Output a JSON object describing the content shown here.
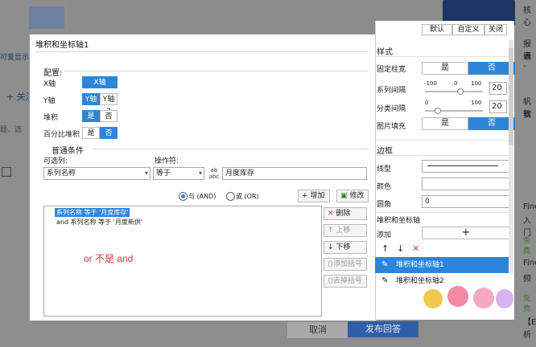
{
  "background": {
    "left_link": "可爱显示",
    "left_follow": "+ 关注",
    "left_misc": "题、选",
    "right_texts": [
      "核心",
      "报表",
      "通 -",
      "帆软",
      "赛",
      "Fine",
      "入门",
      "免费",
      "Fine",
      "频",
      "免费",
      "【E",
      "析"
    ],
    "cancel_label": "取消",
    "submit_label": "发布回答",
    "colors": {
      "submit": "#2f5fa8"
    }
  },
  "dialog": {
    "title": "堆积和坐标轴1",
    "config_label": "配置:",
    "x_axis_label": "X轴",
    "x_axis_value": "X轴",
    "y_axis_label": "Y轴",
    "y_axis_options": [
      "Y轴",
      "Y轴2"
    ],
    "stack_label": "堆积",
    "stack_options": [
      "是",
      "否"
    ],
    "percent_label": "百分比堆积",
    "percent_options": [
      "是",
      "否"
    ],
    "conditions_label": "普通条件",
    "selectable_label": "可选列:",
    "operator_label": "操作符:",
    "selected_column": "系列名称",
    "operator_value": "等于",
    "condition_value": "月度库存",
    "value_icon": "formula-icon",
    "and_label": "与 (AND)",
    "or_label": "或 (OR)",
    "add_label": "增加",
    "edit_label": "修改",
    "conditions": [
      "系列名称 等于 '月度库存'",
      "and 系列名称 等于 '月度新供'"
    ],
    "annotation": "or 不是 and",
    "delete_label": "删除",
    "move_up_label": "上移",
    "move_down_label": "下移",
    "add_bracket_label": "添加括号",
    "remove_bracket_label": "去掉括号",
    "colors": {
      "accent": "#2d85d9",
      "annotation": "#d93a3a"
    }
  },
  "panel": {
    "top_tabs": [
      "默认",
      "自定义",
      "关闭"
    ],
    "style_label": "样式",
    "fixed_width_label": "固定柱宽",
    "yes": "是",
    "no": "否",
    "series_gap_label": "系列间隔",
    "category_gap_label": "分类间隔",
    "slider_min": "-100",
    "slider_mid": "0",
    "slider_max": "100",
    "slider_min2": "0",
    "slider_max2": "100",
    "series_gap_value": "20",
    "category_gap_value": "20",
    "image_fill_label": "图片填充",
    "border_label": "边框",
    "line_type_label": "线型",
    "color_label": "颜色",
    "corner_label": "圆角",
    "corner_value": "0",
    "stack_axis_label": "堆积和坐标轴",
    "add_label": "添加",
    "add_symbol": "+",
    "axis_items": [
      "堆积和坐标轴1",
      "堆积和坐标轴2"
    ],
    "colors": {
      "selected": "#2d85d9"
    }
  }
}
